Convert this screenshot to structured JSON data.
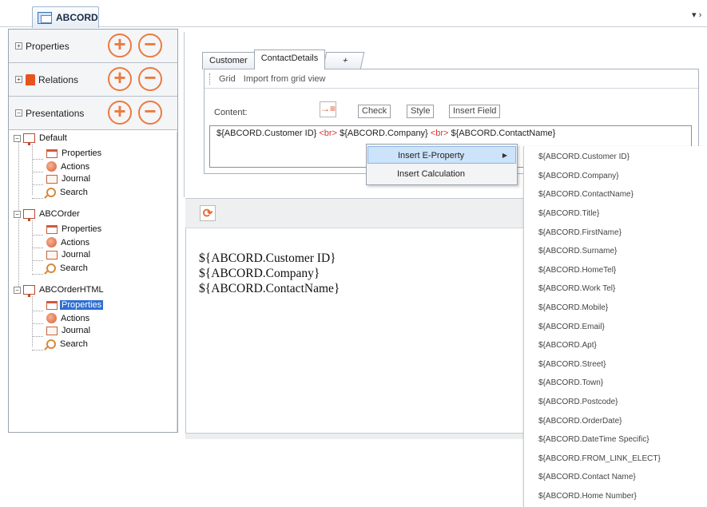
{
  "document_tab": {
    "title": "ABCORD",
    "dropdown_glyph": "▾ ›"
  },
  "left_panel": {
    "sections": [
      {
        "label": "Properties",
        "expander": "+"
      },
      {
        "label": "Relations",
        "expander": "+"
      },
      {
        "label": "Presentations",
        "expander": "−"
      }
    ],
    "tree": [
      {
        "label": "Default",
        "children": [
          "Properties",
          "Actions",
          "Journal",
          "Search"
        ]
      },
      {
        "label": "ABCOrder",
        "children": [
          "Properties",
          "Actions",
          "Journal",
          "Search"
        ]
      },
      {
        "label": "ABCOrderHTML",
        "children": [
          "Properties",
          "Actions",
          "Journal",
          "Search"
        ],
        "selected_child": "Properties"
      }
    ]
  },
  "editor": {
    "tabs": [
      "Customer",
      "ContactDetails",
      "+"
    ],
    "active_tab": "ContactDetails",
    "subtoolbar": {
      "grid": "Grid",
      "import": "Import from grid view"
    },
    "content_label": "Content:",
    "buttons": {
      "check": "Check",
      "style": "Style",
      "insert_field": "Insert Field"
    },
    "content_value": {
      "part1": "${ABCORD.Customer ID} ",
      "br1": "<br>",
      "part2": " ${ABCORD.Company} ",
      "br2": "<br>",
      "part3": " ${ABCORD.ContactName}"
    }
  },
  "preview": {
    "lines": [
      "${ABCORD.Customer ID}",
      "${ABCORD.Company}",
      "${ABCORD.ContactName}"
    ]
  },
  "context_menu": {
    "items": [
      "Insert E-Property",
      "Insert Calculation"
    ],
    "highlighted": "Insert E-Property"
  },
  "submenu": {
    "items": [
      "${ABCORD.Customer ID}",
      "${ABCORD.Company}",
      "${ABCORD.ContactName}",
      "${ABCORD.Title}",
      "${ABCORD.FirstName}",
      "${ABCORD.Surname}",
      "${ABCORD.HomeTel}",
      "${ABCORD.Work Tel}",
      "${ABCORD.Mobile}",
      "${ABCORD.Email}",
      "${ABCORD.Apt}",
      "${ABCORD.Street}",
      "${ABCORD.Town}",
      "${ABCORD.Postcode}",
      "${ABCORD.OrderDate}",
      "${ABCORD.DateTime Specific}",
      "${ABCORD.FROM_LINK_ELECT}",
      "${ABCORD.Contact Name}",
      "${ABCORD.Home Number}"
    ]
  },
  "colors": {
    "accent_orange": "#ec7a3e",
    "selection_blue": "#2f6fd2",
    "menu_highlight": "#cde3f9"
  }
}
